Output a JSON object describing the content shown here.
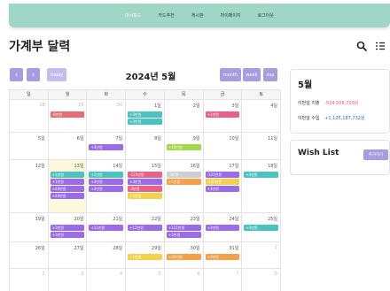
{
  "nav": {
    "items": [
      "대시보드",
      "카드추천",
      "게시판",
      "마이페이지",
      "로그아웃"
    ],
    "active_index": 0
  },
  "page": {
    "title": "가계부 달력"
  },
  "icons": {
    "search": "search-icon",
    "list": "list-icon"
  },
  "controls": {
    "prev": "‹",
    "next": "›",
    "today": "today",
    "month": "month",
    "week": "week",
    "day": "day",
    "title": "2024년 5월"
  },
  "weekdays": [
    "일",
    "월",
    "화",
    "수",
    "목",
    "금",
    "토"
  ],
  "colors": {
    "accent": "#a99be0",
    "nav": "#9fd6c6",
    "expense": "#e8617a",
    "income": "#2b6fd1",
    "red": "#e86a72",
    "teal": "#4cc3c1",
    "purple": "#9b6be8",
    "orange": "#f5a04a",
    "green": "#a5d64c",
    "yellow": "#f2d24a",
    "pink": "#e8618a",
    "gray": "#cfcfcf"
  },
  "weeks": [
    {
      "days": [
        {
          "num": "28",
          "other": true,
          "events": []
        },
        {
          "num": "29",
          "other": true,
          "events": [
            {
              "label": "-8만원",
              "color": "red"
            }
          ]
        },
        {
          "num": "30",
          "other": true,
          "events": []
        },
        {
          "num": "1일",
          "events": [
            {
              "label": "+3만원",
              "color": "teal"
            },
            {
              "label": "+3만원",
              "color": "teal"
            }
          ]
        },
        {
          "num": "2일",
          "events": []
        },
        {
          "num": "3일",
          "events": [
            {
              "label": "+1만원",
              "color": "pink"
            }
          ]
        },
        {
          "num": "4일",
          "events": []
        }
      ]
    },
    {
      "days": [
        {
          "num": "5일",
          "events": []
        },
        {
          "num": "6일",
          "events": []
        },
        {
          "num": "7일",
          "events": [
            {
              "label": "+3만원",
              "color": "purple"
            }
          ]
        },
        {
          "num": "8일",
          "events": []
        },
        {
          "num": "9일",
          "events": [
            {
              "label": "+10만원",
              "color": "green"
            }
          ]
        },
        {
          "num": "10일",
          "events": []
        },
        {
          "num": "11일",
          "events": []
        }
      ]
    },
    {
      "days": [
        {
          "num": "12일",
          "events": []
        },
        {
          "num": "13일",
          "today": true,
          "events": [
            {
              "label": "+1만원",
              "color": "teal"
            },
            {
              "label": "+1만원",
              "color": "purple"
            },
            {
              "label": "+44만원",
              "color": "purple"
            },
            {
              "label": "+44만원",
              "color": "purple"
            }
          ]
        },
        {
          "num": "14일",
          "events": [
            {
              "label": "+1만원",
              "color": "teal"
            },
            {
              "label": "+3만원",
              "color": "purple"
            },
            {
              "label": "+3만원",
              "color": "purple"
            }
          ]
        },
        {
          "num": "15일",
          "events": [
            {
              "label": "-121만원",
              "color": "pink"
            },
            {
              "label": "+3만원",
              "color": "purple"
            },
            {
              "label": "-3만원",
              "color": "pink"
            },
            {
              "label": "+2만원",
              "color": "yellow"
            }
          ]
        },
        {
          "num": "16일",
          "events": [
            {
              "label": "-3만원",
              "color": "gray"
            },
            {
              "label": "+1만원",
              "color": "orange"
            }
          ]
        },
        {
          "num": "17일",
          "events": [
            {
              "label": "-121만원",
              "color": "purple"
            },
            {
              "label": "-121만원",
              "color": "yellow"
            },
            {
              "label": "+3만원",
              "color": "purple"
            }
          ]
        },
        {
          "num": "18일",
          "events": [
            {
              "label": "+3만원",
              "color": "teal"
            }
          ]
        }
      ]
    },
    {
      "days": [
        {
          "num": "19일",
          "events": []
        },
        {
          "num": "20일",
          "events": [
            {
              "label": "+3만원",
              "color": "purple"
            },
            {
              "label": "+3만원",
              "color": "purple"
            }
          ]
        },
        {
          "num": "21일",
          "events": [
            {
              "label": "+11만원",
              "color": "purple"
            }
          ]
        },
        {
          "num": "22일",
          "events": [
            {
              "label": "+12만원",
              "color": "purple"
            }
          ]
        },
        {
          "num": "23일",
          "events": [
            {
              "label": "+121만원",
              "color": "purple"
            },
            {
              "label": "+3만원",
              "color": "purple"
            }
          ]
        },
        {
          "num": "24일",
          "events": [
            {
              "label": "+3만원",
              "color": "purple"
            }
          ]
        },
        {
          "num": "25일",
          "events": [
            {
              "label": "+3만원",
              "color": "teal"
            }
          ]
        }
      ]
    },
    {
      "days": [
        {
          "num": "26일",
          "events": []
        },
        {
          "num": "27일",
          "events": []
        },
        {
          "num": "28일",
          "events": []
        },
        {
          "num": "29일",
          "events": [
            {
              "label": "+1만원",
              "color": "yellow"
            }
          ]
        },
        {
          "num": "30일",
          "events": [
            {
              "label": "+25만원",
              "color": "orange"
            }
          ]
        },
        {
          "num": "31일",
          "events": [
            {
              "label": "+3만원",
              "color": "orange"
            }
          ]
        },
        {
          "num": "1",
          "other": true,
          "events": []
        }
      ]
    },
    {
      "days": [
        {
          "num": "2",
          "other": true,
          "events": []
        },
        {
          "num": "3",
          "other": true,
          "events": []
        },
        {
          "num": "4",
          "other": true,
          "events": []
        },
        {
          "num": "5",
          "other": true,
          "events": []
        },
        {
          "num": "6",
          "other": true,
          "events": []
        },
        {
          "num": "7",
          "other": true,
          "events": []
        },
        {
          "num": "8",
          "other": true,
          "events": []
        }
      ]
    }
  ],
  "summary": {
    "month": "5월",
    "expense_label": "이번달 지출",
    "expense_value": "-524,508,709원",
    "income_label": "이번달 수입",
    "income_value": "+1,125,187,732원"
  },
  "wishlist": {
    "title": "Wish List",
    "add": "추가하기"
  }
}
